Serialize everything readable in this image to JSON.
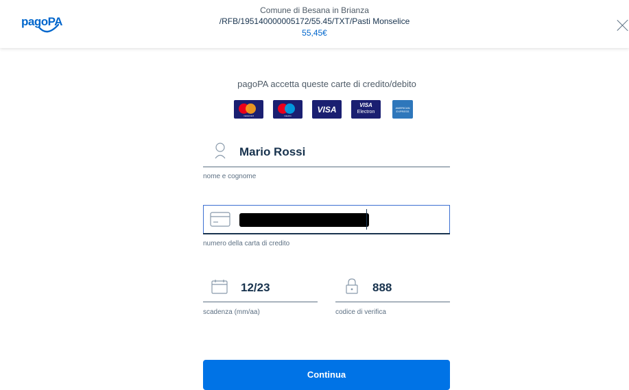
{
  "header": {
    "logo_text": "pagoPA",
    "creditor": "Comune di Besana in Brianza",
    "payment_reference": "/RFB/195140000005172/55.45/TXT/Pasti Monselice",
    "amount": "55,45€"
  },
  "accepted_cards": {
    "title": "pagoPA accetta queste carte di credito/debito",
    "brands": [
      "mastercard",
      "maestro",
      "VISA",
      "VISA Electron",
      "AMERICAN EXPRESS"
    ]
  },
  "form": {
    "name": {
      "value": "Mario Rossi",
      "label": "nome e cognome",
      "icon": "user-icon"
    },
    "card_number": {
      "label": "numero della carta di credito",
      "icon": "credit-card-icon",
      "masked": true
    },
    "expiry": {
      "value": "12/23",
      "label": "scadenza (mm/aa)",
      "icon": "calendar-icon"
    },
    "cvv": {
      "value": "888",
      "label": "codice di verifica",
      "icon": "lock-icon"
    }
  },
  "actions": {
    "continue_label": "Continua"
  },
  "colors": {
    "brand": "#0066cc",
    "button": "#0073e6",
    "text": "#17324d",
    "helper": "#5c6f82"
  }
}
